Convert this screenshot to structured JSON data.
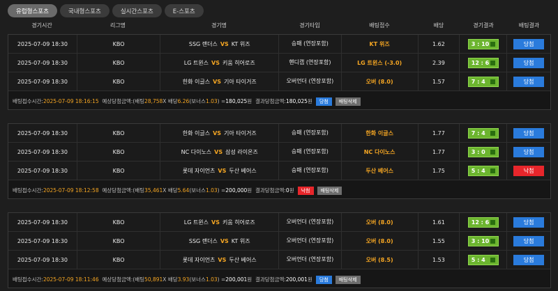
{
  "tabs": [
    "유럽형스포츠",
    "국내형스포츠",
    "실시간스포츠",
    "E-스포츠"
  ],
  "columns": [
    "경기시간",
    "리그명",
    "경기명",
    "경기타입",
    "배팅접수",
    "배당",
    "경기결과",
    "배팅결과"
  ],
  "vs_label": "VS",
  "summary_labels": {
    "time": "배팅접수시간:",
    "expected": "예상당첨금액:",
    "bet": "(배팅",
    "x": "X 배당",
    "bonus_open": "(보너스",
    "eq": ") =",
    "won": "원",
    "result": "결과당첨금액:",
    "delete": "배팅삭제"
  },
  "bets": [
    {
      "rows": [
        {
          "time": "2025-07-09 18:30",
          "league": "KBO",
          "home": "SSG 랜더스",
          "away": "KT 위즈",
          "type": "승패 (연장포함)",
          "pick": "KT 위즈",
          "odds": "1.62",
          "score": "3 : 10",
          "result": "당첨"
        },
        {
          "time": "2025-07-09 18:30",
          "league": "KBO",
          "home": "LG 트윈스",
          "away": "키움 히어로즈",
          "type": "핸디캡 (연장포함)",
          "pick": "LG 트윈스 (-3.0)",
          "odds": "2.39",
          "score": "12 : 6",
          "result": "당첨"
        },
        {
          "time": "2025-07-09 18:30",
          "league": "KBO",
          "home": "한화 이글스",
          "away": "기아 타이거즈",
          "type": "오버언더 (연장포함)",
          "pick": "오버 (8.0)",
          "odds": "1.57",
          "score": "7 : 4",
          "result": "당첨"
        }
      ],
      "bet_time": "2025-07-09 18:16:15",
      "stake": "28,758",
      "total_odds": "6.26",
      "bonus": "1.03",
      "expected": "180,025",
      "actual": "180,025",
      "status": "당첨"
    },
    {
      "rows": [
        {
          "time": "2025-07-09 18:30",
          "league": "KBO",
          "home": "한화 이글스",
          "away": "기아 타이거즈",
          "type": "승패 (연장포함)",
          "pick": "한화 이글스",
          "odds": "1.77",
          "score": "7 : 4",
          "result": "당첨"
        },
        {
          "time": "2025-07-09 18:30",
          "league": "KBO",
          "home": "NC 다이노스",
          "away": "삼성 라이온즈",
          "type": "승패 (연장포함)",
          "pick": "NC 다이노스",
          "odds": "1.77",
          "score": "3 : 0",
          "result": "당첨"
        },
        {
          "time": "2025-07-09 18:30",
          "league": "KBO",
          "home": "롯데 자이언츠",
          "away": "두산 베어스",
          "type": "승패 (연장포함)",
          "pick": "두산 베어스",
          "odds": "1.75",
          "score": "5 : 4",
          "result": "낙첨"
        }
      ],
      "bet_time": "2025-07-09 18:12:58",
      "stake": "35,461",
      "total_odds": "5.64",
      "bonus": "1.03",
      "expected": "200,000",
      "actual": "0",
      "status": "낙첨"
    },
    {
      "rows": [
        {
          "time": "2025-07-09 18:30",
          "league": "KBO",
          "home": "LG 트윈스",
          "away": "키움 히어로즈",
          "type": "오버언더 (연장포함)",
          "pick": "오버 (8.0)",
          "odds": "1.61",
          "score": "12 : 6",
          "result": "당첨"
        },
        {
          "time": "2025-07-09 18:30",
          "league": "KBO",
          "home": "SSG 랜더스",
          "away": "KT 위즈",
          "type": "오버언더 (연장포함)",
          "pick": "오버 (8.0)",
          "odds": "1.55",
          "score": "3 : 10",
          "result": "당첨"
        },
        {
          "time": "2025-07-09 18:30",
          "league": "KBO",
          "home": "롯데 자이언츠",
          "away": "두산 베어스",
          "type": "오버언더 (연장포함)",
          "pick": "오버 (8.5)",
          "odds": "1.53",
          "score": "5 : 4",
          "result": "당첨"
        }
      ],
      "bet_time": "2025-07-09 18:11:46",
      "stake": "50,891",
      "total_odds": "3.93",
      "bonus": "1.03",
      "expected": "200,001",
      "actual": "200,001",
      "status": "당첨"
    }
  ],
  "colors": {
    "win": "#2a7bdc",
    "lose": "#e8262b",
    "score_bg": "#6cb52f",
    "accent": "#f5a623"
  }
}
